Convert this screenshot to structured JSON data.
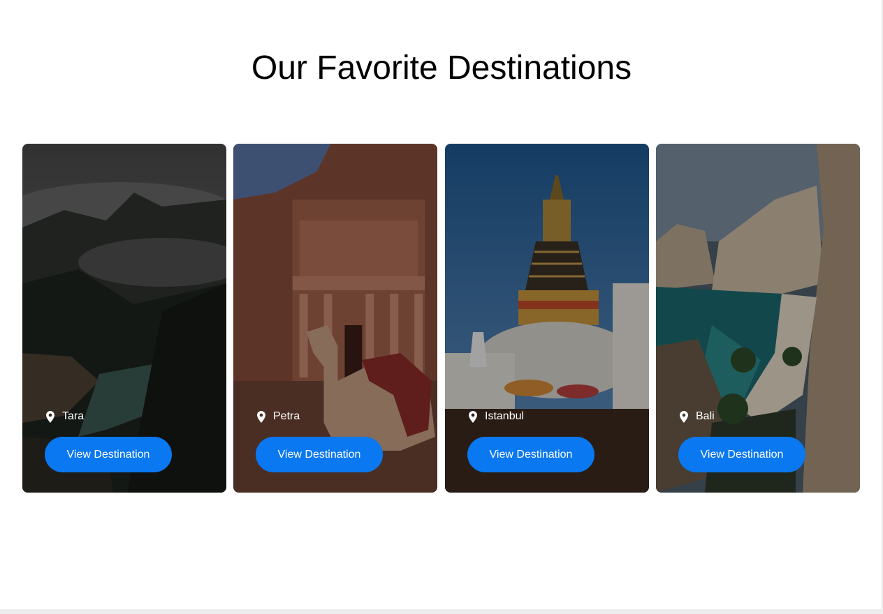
{
  "page": {
    "title": "Our Favorite Destinations"
  },
  "destinations": [
    {
      "name": "Tara",
      "button_label": "View Destination",
      "image": "misty-mountain-lake-photo"
    },
    {
      "name": "Petra",
      "button_label": "View Destination",
      "image": "petra-treasury-camel-photo"
    },
    {
      "name": "Istanbul",
      "button_label": "View Destination",
      "image": "stupa-temple-photo"
    },
    {
      "name": "Bali",
      "button_label": "View Destination",
      "image": "coastal-cliffs-beach-photo"
    }
  ],
  "colors": {
    "button_background": "#0a78f0",
    "button_text": "#ffffff",
    "title_text": "#000000"
  },
  "icons": {
    "location": "map-pin-icon"
  }
}
